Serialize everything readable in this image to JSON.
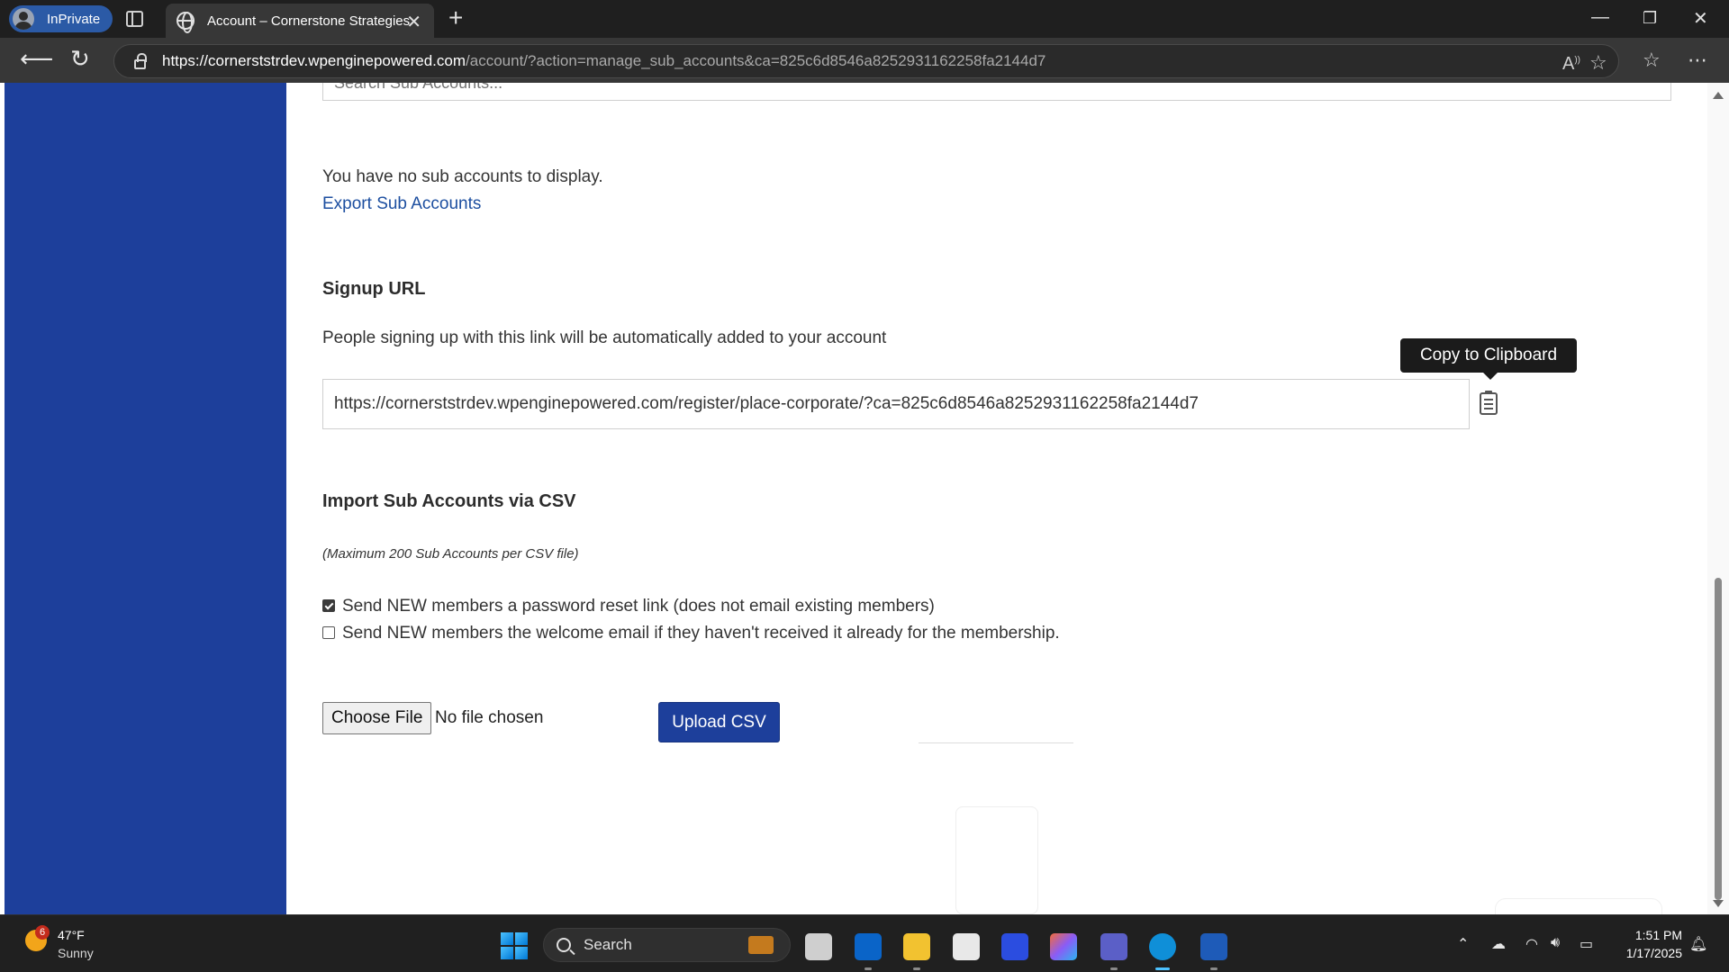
{
  "browser": {
    "profile_label": "InPrivate",
    "tab_title": "Account – Cornerstone Strategies",
    "tab_close": "✕",
    "new_tab": "+",
    "url_host": "https://cornerststrdev.wpenginepowered.com",
    "url_path": "/account/?action=manage_sub_accounts&ca=825c6d8546a8252931162258fa2144d7",
    "window_controls": {
      "minimize": "—",
      "maximize": "❐",
      "close": "✕"
    }
  },
  "page": {
    "search_placeholder": "Search Sub Accounts...",
    "no_sub_accounts": "You have no sub accounts to display.",
    "export_link": "Export Sub Accounts",
    "signup": {
      "heading": "Signup URL",
      "description": "People signing up with this link will be automatically added to your account",
      "url": "https://cornerststrdev.wpenginepowered.com/register/place-corporate/?ca=825c6d8546a8252931162258fa2144d7",
      "copy_tooltip": "Copy to Clipboard"
    },
    "import": {
      "heading": "Import Sub Accounts via CSV",
      "note": "(Maximum 200 Sub Accounts per CSV file)",
      "option_reset": {
        "label": "Send NEW members a password reset link (does not email existing members)",
        "checked": true
      },
      "option_welcome": {
        "label": "Send NEW members the welcome email if they haven't received it already for the membership.",
        "checked": false
      },
      "choose_file": "Choose File",
      "no_file": "No file chosen",
      "upload": "Upload CSV"
    }
  },
  "taskbar": {
    "weather_badge": "6",
    "weather_temp": "47°F",
    "weather_cond": "Sunny",
    "search_label": "Search",
    "time": "1:51 PM",
    "date": "1/17/2025"
  },
  "colors": {
    "sidebar": "#1d3f9b",
    "primary_button": "#1d3f9b",
    "link": "#1d4fa0"
  }
}
